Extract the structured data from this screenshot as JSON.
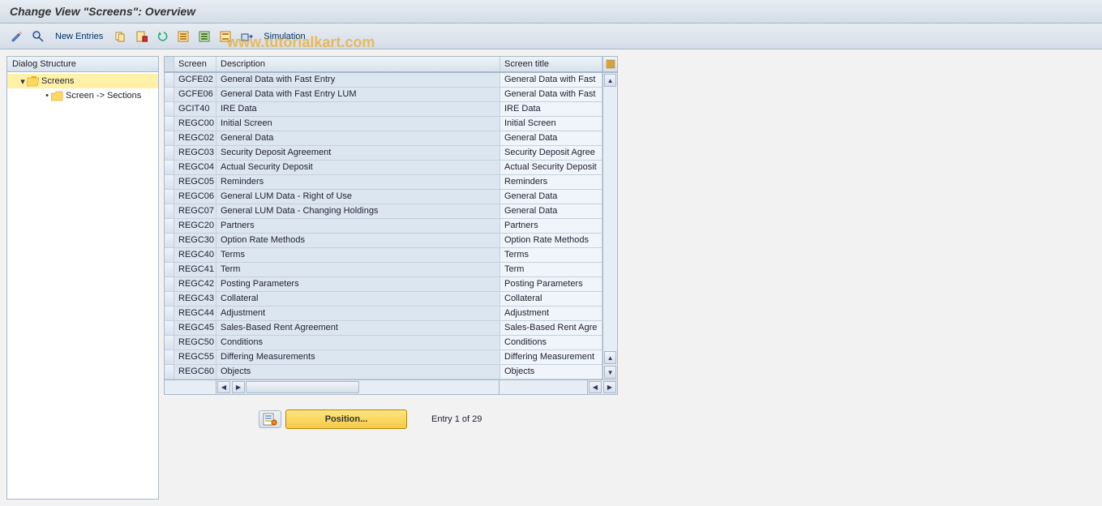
{
  "title": "Change View \"Screens\": Overview",
  "toolbar": {
    "new_entries": "New Entries",
    "simulation": "Simulation"
  },
  "watermark": "www.tutorialkart.com",
  "sidebar": {
    "header": "Dialog Structure",
    "items": [
      {
        "label": "Screens",
        "open": true,
        "selected": true,
        "level": 1
      },
      {
        "label": "Screen -> Sections",
        "open": false,
        "selected": false,
        "level": 2
      }
    ]
  },
  "grid": {
    "headers": {
      "screen": "Screen",
      "description": "Description",
      "title": "Screen title"
    },
    "rows": [
      {
        "screen": "GCFE02",
        "description": "General Data with Fast Entry",
        "title": "General Data with Fast"
      },
      {
        "screen": "GCFE06",
        "description": "General Data with Fast Entry LUM",
        "title": "General Data with Fast"
      },
      {
        "screen": "GCIT40",
        "description": "IRE Data",
        "title": "IRE Data"
      },
      {
        "screen": "REGC00",
        "description": "Initial Screen",
        "title": "Initial Screen"
      },
      {
        "screen": "REGC02",
        "description": "General Data",
        "title": "General Data"
      },
      {
        "screen": "REGC03",
        "description": "Security Deposit Agreement",
        "title": "Security Deposit Agree"
      },
      {
        "screen": "REGC04",
        "description": "Actual Security Deposit",
        "title": "Actual Security Deposit"
      },
      {
        "screen": "REGC05",
        "description": "Reminders",
        "title": "Reminders"
      },
      {
        "screen": "REGC06",
        "description": "General LUM Data - Right of Use",
        "title": "General Data"
      },
      {
        "screen": "REGC07",
        "description": "General LUM Data - Changing Holdings",
        "title": "General Data"
      },
      {
        "screen": "REGC20",
        "description": "Partners",
        "title": "Partners"
      },
      {
        "screen": "REGC30",
        "description": "Option Rate Methods",
        "title": "Option Rate Methods"
      },
      {
        "screen": "REGC40",
        "description": "Terms",
        "title": "Terms"
      },
      {
        "screen": "REGC41",
        "description": "Term",
        "title": "Term"
      },
      {
        "screen": "REGC42",
        "description": "Posting Parameters",
        "title": "Posting Parameters"
      },
      {
        "screen": "REGC43",
        "description": "Collateral",
        "title": "Collateral"
      },
      {
        "screen": "REGC44",
        "description": "Adjustment",
        "title": "Adjustment"
      },
      {
        "screen": "REGC45",
        "description": "Sales-Based Rent Agreement",
        "title": "Sales-Based Rent Agre"
      },
      {
        "screen": "REGC50",
        "description": "Conditions",
        "title": "Conditions"
      },
      {
        "screen": "REGC55",
        "description": "Differing Measurements",
        "title": "Differing Measurement"
      },
      {
        "screen": "REGC60",
        "description": "Objects",
        "title": "Objects"
      }
    ]
  },
  "footer": {
    "position_label": "Position...",
    "entry_label": "Entry 1 of 29"
  }
}
